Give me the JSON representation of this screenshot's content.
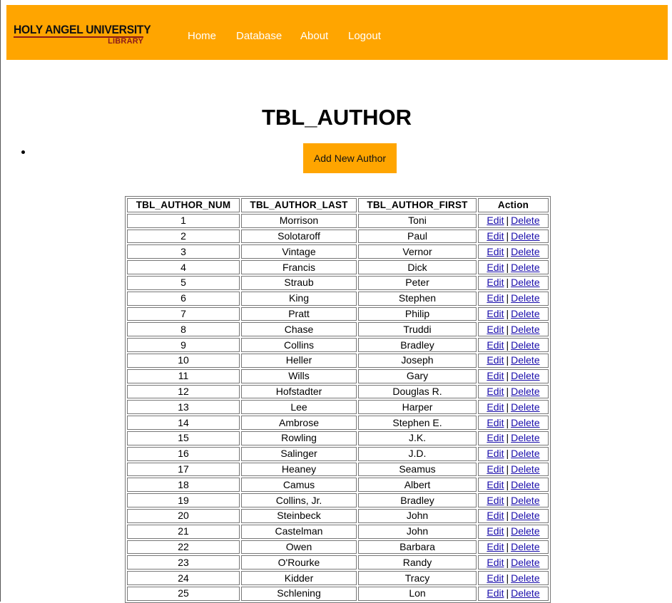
{
  "header": {
    "logo_top": "HOLY ANGEL UNIVERSITY",
    "logo_bottom": "LIBRARY",
    "nav": [
      "Home",
      "Database",
      "About",
      "Logout"
    ]
  },
  "page": {
    "title": "TBL_AUTHOR",
    "add_button": "Add New Author"
  },
  "table": {
    "columns": [
      "TBL_AUTHOR_NUM",
      "TBL_AUTHOR_LAST",
      "TBL_AUTHOR_FIRST",
      "Action"
    ],
    "edit_label": "Edit",
    "delete_label": "Delete",
    "separator": "|",
    "rows": [
      [
        "1",
        "Morrison",
        "Toni"
      ],
      [
        "2",
        "Solotaroff",
        "Paul"
      ],
      [
        "3",
        "Vintage",
        "Vernor"
      ],
      [
        "4",
        "Francis",
        "Dick"
      ],
      [
        "5",
        "Straub",
        "Peter"
      ],
      [
        "6",
        "King",
        "Stephen"
      ],
      [
        "7",
        "Pratt",
        "Philip"
      ],
      [
        "8",
        "Chase",
        "Truddi"
      ],
      [
        "9",
        "Collins",
        "Bradley"
      ],
      [
        "10",
        "Heller",
        "Joseph"
      ],
      [
        "11",
        "Wills",
        "Gary"
      ],
      [
        "12",
        "Hofstadter",
        "Douglas R."
      ],
      [
        "13",
        "Lee",
        "Harper"
      ],
      [
        "14",
        "Ambrose",
        "Stephen E."
      ],
      [
        "15",
        "Rowling",
        "J.K."
      ],
      [
        "16",
        "Salinger",
        "J.D."
      ],
      [
        "17",
        "Heaney",
        "Seamus"
      ],
      [
        "18",
        "Camus",
        "Albert"
      ],
      [
        "19",
        "Collins, Jr.",
        "Bradley"
      ],
      [
        "20",
        "Steinbeck",
        "John"
      ],
      [
        "21",
        "Castelman",
        "John"
      ],
      [
        "22",
        "Owen",
        "Barbara"
      ],
      [
        "23",
        "O'Rourke",
        "Randy"
      ],
      [
        "24",
        "Kidder",
        "Tracy"
      ],
      [
        "25",
        "Schlening",
        "Lon"
      ]
    ]
  },
  "colors": {
    "accent": "#FFA500",
    "nav_text": "#FFFFFF",
    "link": "#1A0DAB"
  }
}
